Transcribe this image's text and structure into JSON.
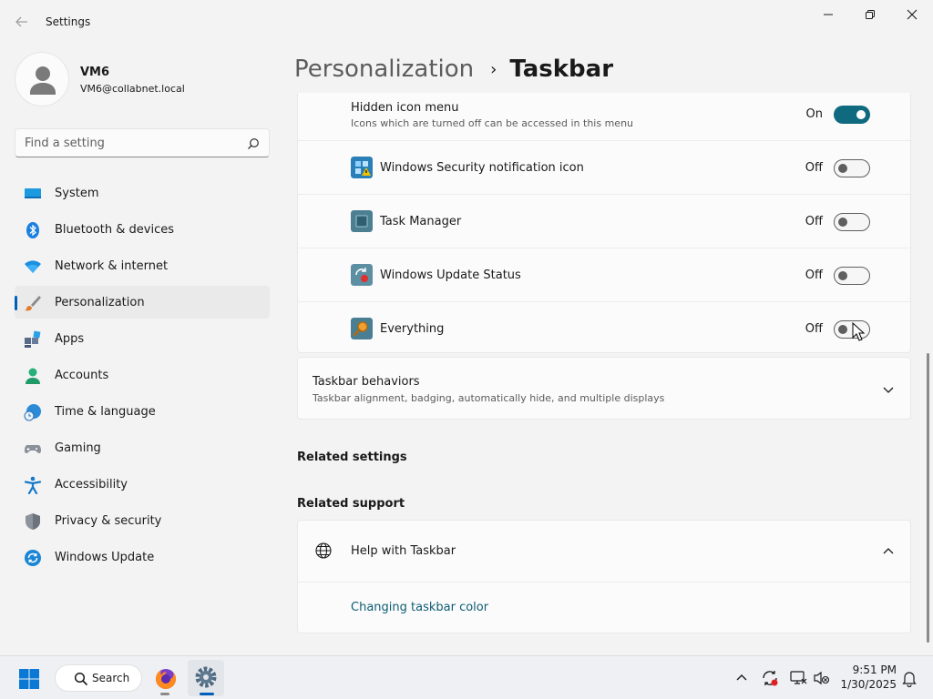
{
  "window": {
    "title": "Settings",
    "accent": "#005fb8"
  },
  "user": {
    "name": "VM6",
    "email": "VM6@collabnet.local"
  },
  "search": {
    "placeholder": "Find a setting"
  },
  "nav": [
    {
      "label": "System",
      "icon": "monitor-icon"
    },
    {
      "label": "Bluetooth & devices",
      "icon": "bluetooth-icon"
    },
    {
      "label": "Network & internet",
      "icon": "wifi-icon"
    },
    {
      "label": "Personalization",
      "icon": "paintbrush-icon",
      "selected": true
    },
    {
      "label": "Apps",
      "icon": "apps-icon"
    },
    {
      "label": "Accounts",
      "icon": "person-icon"
    },
    {
      "label": "Time & language",
      "icon": "clock-globe-icon"
    },
    {
      "label": "Gaming",
      "icon": "gamepad-icon"
    },
    {
      "label": "Accessibility",
      "icon": "accessibility-icon"
    },
    {
      "label": "Privacy & security",
      "icon": "shield-icon"
    },
    {
      "label": "Windows Update",
      "icon": "update-icon"
    }
  ],
  "breadcrumb": {
    "parent": "Personalization",
    "separator": "›",
    "current": "Taskbar"
  },
  "hidden_menu": {
    "title": "Hidden icon menu",
    "subtitle": "Icons which are turned off can be accessed in this menu",
    "state": "On",
    "on": true
  },
  "tray_apps": [
    {
      "label": "Windows Security notification icon",
      "state": "Off",
      "on": false,
      "icon": "windows-security-icon"
    },
    {
      "label": "Task Manager",
      "state": "Off",
      "on": false,
      "icon": "task-manager-icon"
    },
    {
      "label": "Windows Update Status",
      "state": "Off",
      "on": false,
      "icon": "windows-update-status-icon"
    },
    {
      "label": "Everything",
      "state": "Off",
      "on": false,
      "icon": "everything-search-icon"
    }
  ],
  "taskbar_behaviors": {
    "title": "Taskbar behaviors",
    "subtitle": "Taskbar alignment, badging, automatically hide, and multiple displays"
  },
  "related_settings": {
    "heading": "Related settings"
  },
  "related_support": {
    "heading": "Related support",
    "help_title": "Help with Taskbar",
    "link": "Changing taskbar color"
  },
  "taskbar": {
    "search_label": "Search",
    "time": "9:51 PM",
    "date": "1/30/2025"
  }
}
